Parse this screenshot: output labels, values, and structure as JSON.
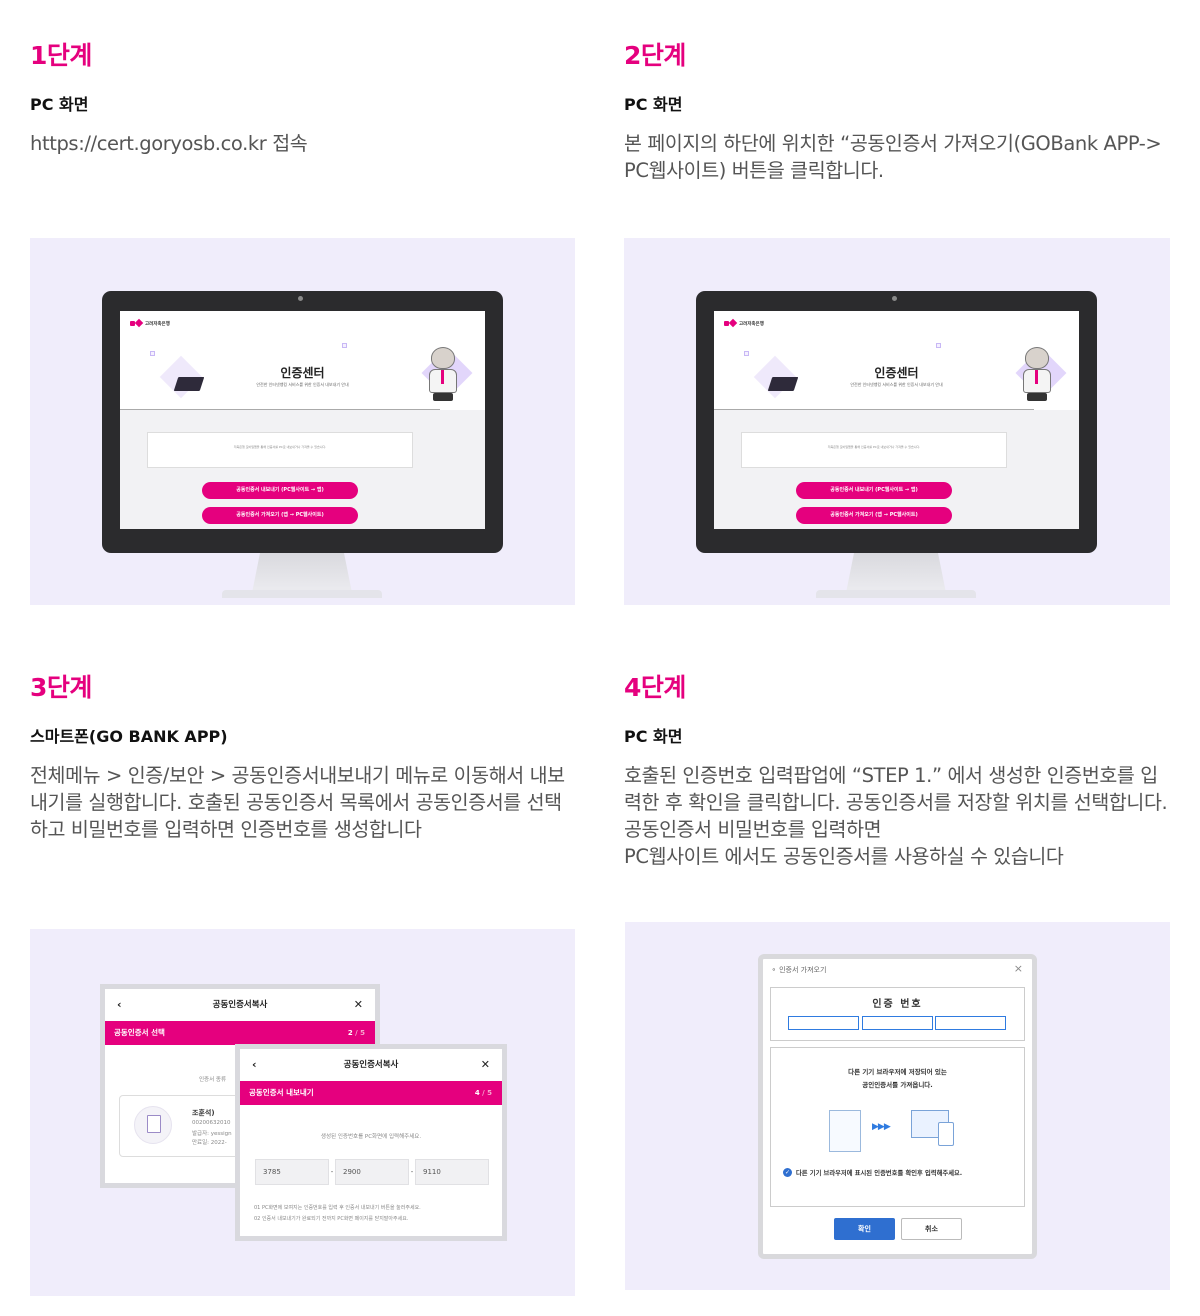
{
  "steps": [
    {
      "title": "1단계",
      "subtitle": "PC 화면",
      "desc": "https://cert.goryosb.co.kr 접속"
    },
    {
      "title": "2단계",
      "subtitle": "PC 화면",
      "desc": "본 페이지의 하단에 위치한 “공동인증서 가져오기(GOBank APP-> PC웹사이트) 버튼을 클릭합니다."
    },
    {
      "title": "3단계",
      "subtitle": "스마트폰(GO BANK APP)",
      "desc": "전체메뉴 > 인증/보안 > 공동인증서내보내기 메뉴로 이동해서 내보내기를 실행합니다. 호출된 공동인증서 목록에서 공동인증서를 선택하고 비밀번호를 입력하면 인증번호를 생성합니다"
    },
    {
      "title": "4단계",
      "subtitle": "PC 화면",
      "desc": "호출된 인증번호 입력팝업에 “STEP 1.” 에서 생성한 인증번호를 입력한 후 확인을 클릭합니다. 공동인증서를 저장할 위치를 선택합니다. 공동인증서 비밀번호를 입력하면\nPC웹사이트 에서도 공동인증서를 사용하실 수 있습니다"
    }
  ],
  "monitor": {
    "logo_text": "고려저축은행",
    "hero_title": "인증센터",
    "hero_sub": "안전한 인터넷뱅킹 서비스를 위한 인증서 내보내기 안내",
    "notice": "저축은행 모바일앱을 통해 인증서를 PC로 내보내거나 가져올 수 있습니다.",
    "btn_export": "공동인증서 내보내기 (PC웹사이트 → 앱)",
    "btn_import": "공동인증서 가져오기 (앱 → PC웹사이트)"
  },
  "phone": {
    "header": "공동인증서복사",
    "bar1": "공동인증서 선택",
    "step1": "2",
    "step_total": " / 5",
    "cert_type_label": "인증서 종류",
    "cert_name": "조훈석)",
    "cert_num": "00200632010",
    "cert_issuer": "발급자: yessign",
    "cert_expiry": "만료일: 2022-",
    "bar2": "공동인증서 내보내기",
    "step2": "4",
    "instruction": "생성된 인증번호를 PC화면에 입력해주세요.",
    "codes": [
      "3785",
      "2900",
      "9110"
    ],
    "note1": "01 PC화면에 보여지는 인증번호를 입력 후 인증서 내보내기 버튼을 눌러주세요.",
    "note2": "02 인증서 내보내기가 완료되기 전까지 PC화면 페이지를 닫지말아주세요."
  },
  "dialog": {
    "title": "인증서 가져오기",
    "label": "인증 번호",
    "message_line1": "다른 기기 브라우저에 저장되어 있는",
    "message_line2": "공인인증서를 가져옵니다.",
    "check_text": "다른 기기 브라우저에 표시된 인증번호를 확인후 입력해주세요.",
    "ok": "확인",
    "cancel": "취소"
  }
}
